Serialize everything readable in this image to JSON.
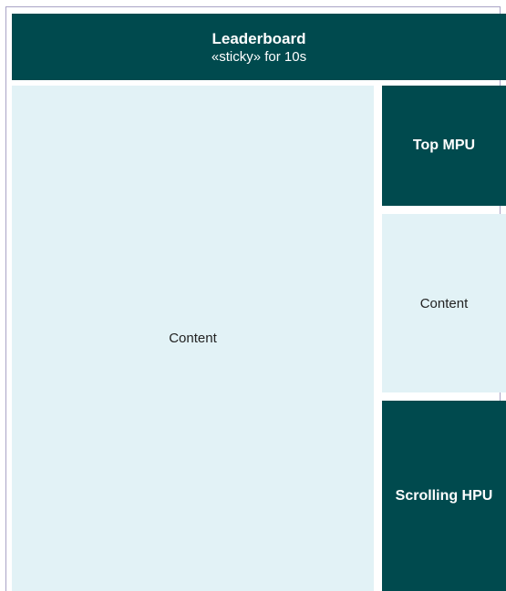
{
  "leaderboard": {
    "title": "Leaderboard",
    "subtitle": "«sticky» for 10s"
  },
  "main_content": {
    "label": "Content"
  },
  "top_mpu": {
    "label": "Top MPU"
  },
  "side_content": {
    "label": "Content"
  },
  "scrolling_hpu": {
    "label": "Scrolling HPU"
  },
  "colors": {
    "dark_block": "#004a4e",
    "light_block": "#e2f2f6",
    "frame_border": "#a9a3c6"
  }
}
